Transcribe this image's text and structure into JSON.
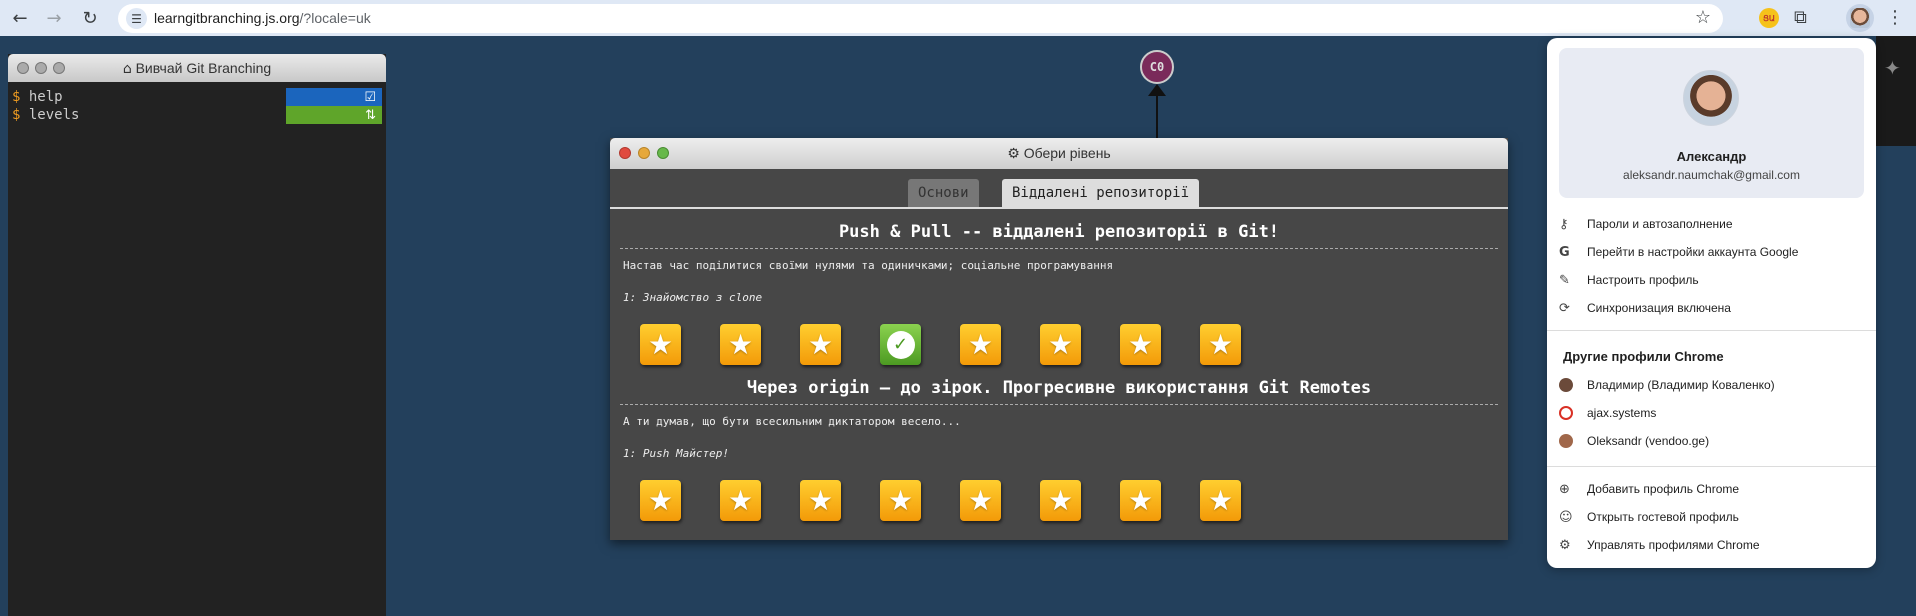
{
  "browser": {
    "url_host": "learngitbranching.js.org",
    "url_path": "/?locale=uk",
    "ext_badge": "ՑԱ"
  },
  "terminal": {
    "title": "Вивчай Git Branching",
    "lines": [
      {
        "prompt": "$",
        "cmd": "help"
      },
      {
        "prompt": "$",
        "cmd": "levels"
      }
    ]
  },
  "graph": {
    "commit_label": "C0"
  },
  "dialog": {
    "title": "Обери рівень",
    "tabs": [
      "Основи",
      "Віддалені репозиторії"
    ],
    "sequences": [
      {
        "title": "Push & Pull -- віддалені репозиторії в Git!",
        "description": "Настав час поділитися своїми нулями та одиничками; соціальне програмування",
        "level_label": "1: Знайомство з clone",
        "levels": [
          false,
          false,
          false,
          true,
          false,
          false,
          false,
          false
        ]
      },
      {
        "title": "Через origin – до зірок. Прогресивне використання Git Remotes",
        "description": "А ти думав, що бути всесильним диктатором весело...",
        "level_label": "1: Push Майстер!",
        "levels": [
          false,
          false,
          false,
          false,
          false,
          false,
          false,
          false
        ]
      }
    ]
  },
  "profile": {
    "name": "Александр",
    "email": "aleksandr.naumchak@gmail.com",
    "menu": [
      {
        "icon": "key-icon",
        "label": "Пароли и автозаполнение"
      },
      {
        "icon": "google-icon",
        "label": "Перейти в настройки аккаунта Google"
      },
      {
        "icon": "pencil-icon",
        "label": "Настроить профиль"
      },
      {
        "icon": "sync-icon",
        "label": "Синхронизация включена"
      }
    ],
    "other_header": "Другие профили Chrome",
    "others": [
      {
        "label": "Владимир (Владимир Коваленко)",
        "color": "#6b4a3a"
      },
      {
        "label": "ajax.systems",
        "color": "#d93025"
      },
      {
        "label": "Oleksandr (vendoo.ge)",
        "color": "#a0674a"
      }
    ],
    "actions": [
      {
        "icon": "add-person-icon",
        "label": "Добавить профиль Chrome"
      },
      {
        "icon": "guest-icon",
        "label": "Открыть гостевой профиль"
      },
      {
        "icon": "manage-profiles-icon",
        "label": "Управлять профилями Chrome"
      }
    ]
  }
}
